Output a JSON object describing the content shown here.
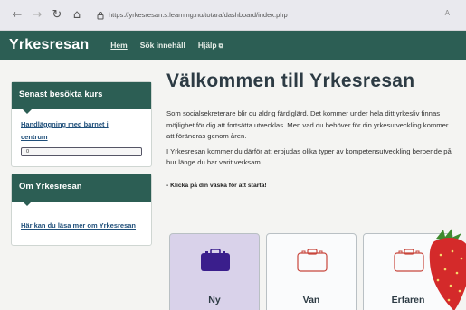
{
  "browser": {
    "back": "←",
    "forward": "→",
    "reload": "↻",
    "home": "⌂",
    "lock": "🔒",
    "url": "https://yrkesresan.s.learning.nu/totara/dashboard/index.php",
    "reader_label": "A"
  },
  "header": {
    "brand": "Yrkesresan",
    "nav": {
      "home": "Hem",
      "search": "Sök innehåll",
      "help": "Hjälp"
    }
  },
  "sidebar": {
    "recent": {
      "title": "Senast besökta kurs",
      "course_line1": "Handläggning med barnet i",
      "course_line2": "centrum",
      "progress": "0"
    },
    "about": {
      "title": "Om Yrkesresan",
      "link": "Här kan du läsa mer om Yrkesresan"
    }
  },
  "main": {
    "title": "Välkommen till Yrkesresan",
    "paragraph1": "Som socialsekreterare blir du aldrig färdiglärd. Det kommer under hela ditt yrkesliv finnas möjlighet för dig att fortsätta utvecklas. Men vad du behöver för din yrkesutveckling kommer att förändras genom åren.",
    "paragraph2": "I Yrkesresan kommer du därför att erbjudas olika typer av kompetensutveckling beroende på hur länge du har varit verksam.",
    "cta": "- Klicka på din väska för att starta!",
    "cards": [
      {
        "label": "Ny",
        "icon": "briefcase-icon",
        "color": "#3a1e8c"
      },
      {
        "label": "Van",
        "icon": "briefcase-outline-icon",
        "color": "#c8463c"
      },
      {
        "label": "Erfaren",
        "icon": "briefcase-outline-icon",
        "color": "#c8463c"
      }
    ]
  },
  "colors": {
    "brand_green": "#2c5e54",
    "link_blue": "#1f4f7a",
    "selected_card": "#d9d2ea"
  }
}
